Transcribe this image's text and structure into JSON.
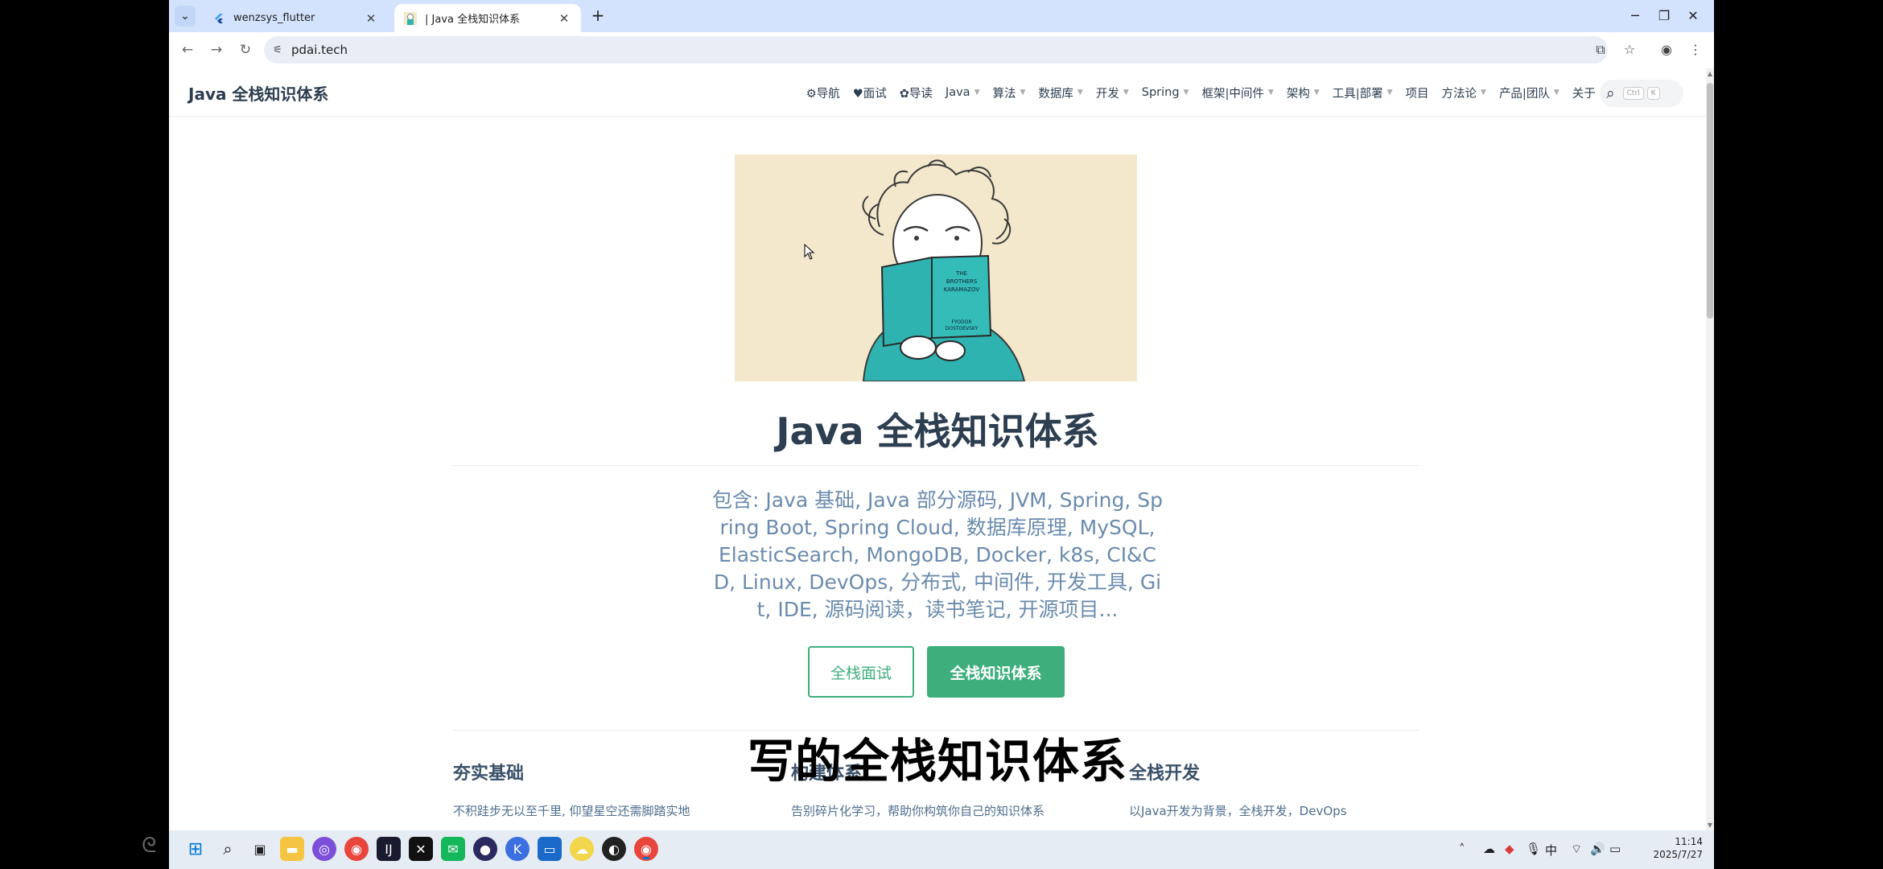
{
  "browser": {
    "tabs": [
      {
        "title": "wenzsys_flutter",
        "active": false
      },
      {
        "title": "| Java 全栈知识体系",
        "active": true
      }
    ],
    "url": "pdai.tech"
  },
  "site": {
    "title": "Java 全栈知识体系",
    "nav": [
      {
        "label": "⚙导航",
        "dropdown": false
      },
      {
        "label": "♥面试",
        "dropdown": false
      },
      {
        "label": "✿导读",
        "dropdown": false
      },
      {
        "label": "Java",
        "dropdown": true
      },
      {
        "label": "算法",
        "dropdown": true
      },
      {
        "label": "数据库",
        "dropdown": true
      },
      {
        "label": "开发",
        "dropdown": true
      },
      {
        "label": "Spring",
        "dropdown": true
      },
      {
        "label": "框架|中间件",
        "dropdown": true
      },
      {
        "label": "架构",
        "dropdown": true
      },
      {
        "label": "工具|部署",
        "dropdown": true
      },
      {
        "label": "项目",
        "dropdown": false
      },
      {
        "label": "方法论",
        "dropdown": true
      },
      {
        "label": "产品|团队",
        "dropdown": true
      },
      {
        "label": "关于",
        "dropdown": false
      }
    ],
    "search_kbd": [
      "Ctrl",
      "K"
    ]
  },
  "hero": {
    "book_title": "THE BROTHERS KARAMAZOV",
    "book_author": "FYODOR DOSTOEVSKY",
    "title": "Java 全栈知识体系",
    "description": "包含: Java 基础, Java 部分源码, JVM, Spring, Spring Boot, Spring Cloud, 数据库原理, MySQL, ElasticSearch, MongoDB, Docker, k8s, CI&CD, Linux, DevOps, 分布式, 中间件, 开发工具, Git, IDE, 源码阅读，读书笔记, 开源项目...",
    "actions": [
      "全栈面试",
      "全栈知识体系"
    ]
  },
  "features": [
    {
      "title": "夯实基础",
      "desc": "不积跬步无以至千里, 仰望星空还需脚踏实地"
    },
    {
      "title": "构建体系",
      "desc": "告别碎片化学习，帮助你构筑你自己的知识体系"
    },
    {
      "title": "全栈开发",
      "desc": "以Java开发为背景，全栈开发，DevOps"
    }
  ],
  "overlay_caption": "写的全栈知识体系",
  "taskbar": {
    "time": "11:14",
    "date": "2025/7/27",
    "ime": "中"
  },
  "colors": {
    "accent": "#3eaf7c",
    "text": "#2c3e50",
    "desc": "#6a8bad",
    "hero_bg": "#f3e8cc",
    "teal": "#2fb3b0"
  }
}
